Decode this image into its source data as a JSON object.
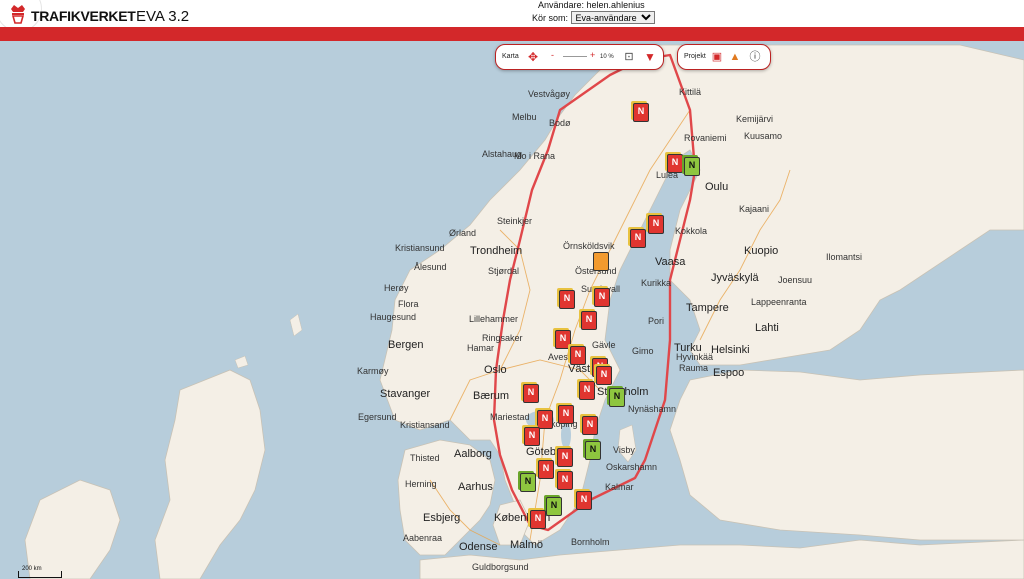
{
  "header": {
    "brand": "TRAFIKVERKET",
    "app_title": "EVA 3.2",
    "user_label": "Användare: helen.ahlenius",
    "run_as_label": "Kör som:",
    "run_as_selected": "Eva-användare"
  },
  "map_toolbar": {
    "label": "Karta",
    "zoom_minus": "-",
    "zoom_plus": "+",
    "zoom_level": "10 %"
  },
  "project_toolbar": {
    "label": "Projekt"
  },
  "map_labels": [
    {
      "text": "Bodø",
      "big": false
    },
    {
      "text": "Luleå",
      "big": false
    },
    {
      "text": "Oulu",
      "big": true
    },
    {
      "text": "Rovaniemi",
      "big": false
    },
    {
      "text": "Trondheim",
      "big": true
    },
    {
      "text": "Kristiansund",
      "big": false
    },
    {
      "text": "Ålesund",
      "big": false
    },
    {
      "text": "Örnsköldsvik",
      "big": false
    },
    {
      "text": "Östersund",
      "big": false
    },
    {
      "text": "Sundsvall",
      "big": false
    },
    {
      "text": "Vaasa",
      "big": true
    },
    {
      "text": "Kuopio",
      "big": true
    },
    {
      "text": "Jyväskylä",
      "big": true
    },
    {
      "text": "Tampere",
      "big": true
    },
    {
      "text": "Lahti",
      "big": true
    },
    {
      "text": "Turku",
      "big": true
    },
    {
      "text": "Helsinki",
      "big": true
    },
    {
      "text": "Espoo",
      "big": true
    },
    {
      "text": "Bergen",
      "big": true
    },
    {
      "text": "Stavanger",
      "big": true
    },
    {
      "text": "Oslo",
      "big": true
    },
    {
      "text": "Bærum",
      "big": true
    },
    {
      "text": "Kristiansand",
      "big": false
    },
    {
      "text": "Gävle",
      "big": false
    },
    {
      "text": "Västerås",
      "big": true
    },
    {
      "text": "Stockholm",
      "big": true
    },
    {
      "text": "Göteborg",
      "big": true
    },
    {
      "text": "Aalborg",
      "big": true
    },
    {
      "text": "Aarhus",
      "big": true
    },
    {
      "text": "Esbjerg",
      "big": true
    },
    {
      "text": "København",
      "big": true
    },
    {
      "text": "Malmö",
      "big": true
    },
    {
      "text": "Odense",
      "big": true
    },
    {
      "text": "Visby",
      "big": false
    },
    {
      "text": "Kalmar",
      "big": false
    },
    {
      "text": "Oskarshamn",
      "big": false
    },
    {
      "text": "Nynäshamn",
      "big": false
    },
    {
      "text": "Mariestad",
      "big": false
    },
    {
      "text": "Linköping",
      "big": false
    },
    {
      "text": "Herning",
      "big": false
    },
    {
      "text": "Thisted",
      "big": false
    },
    {
      "text": "Haugesund",
      "big": false
    },
    {
      "text": "Karmøy",
      "big": false
    },
    {
      "text": "Egersund",
      "big": false
    },
    {
      "text": "Lillehammer",
      "big": false
    },
    {
      "text": "Ringsaker",
      "big": false
    },
    {
      "text": "Steinkjer",
      "big": false
    },
    {
      "text": "Mo i Rana",
      "big": false
    },
    {
      "text": "Kemijärvi",
      "big": false
    },
    {
      "text": "Kuusamo",
      "big": false
    },
    {
      "text": "Kajaani",
      "big": false
    },
    {
      "text": "Joensuu",
      "big": false
    },
    {
      "text": "Lappeenranta",
      "big": false
    },
    {
      "text": "Pori",
      "big": false
    },
    {
      "text": "Kokkola",
      "big": false
    },
    {
      "text": "Kurikka",
      "big": false
    },
    {
      "text": "Ilomantsi",
      "big": false
    },
    {
      "text": "Bornholm",
      "big": false
    },
    {
      "text": "Guldborgsund",
      "big": false
    },
    {
      "text": "Aabenraa",
      "big": false
    },
    {
      "text": "Rauma",
      "big": false
    },
    {
      "text": "Melbu",
      "big": false
    },
    {
      "text": "Alstahaug",
      "big": false
    },
    {
      "text": "Vestvågøy",
      "big": false
    },
    {
      "text": "Kittilä",
      "big": false
    },
    {
      "text": "Ørland",
      "big": false
    },
    {
      "text": "Hyvinkää",
      "big": false
    },
    {
      "text": "Hamar",
      "big": false
    },
    {
      "text": "Flora",
      "big": false
    },
    {
      "text": "Herøy",
      "big": false
    },
    {
      "text": "Stjørdal",
      "big": false
    },
    {
      "text": "Gimo",
      "big": false
    },
    {
      "text": "Avesta",
      "big": false
    }
  ],
  "markers": [
    {
      "letter": "N",
      "color": "red"
    },
    {
      "letter": "N",
      "color": "red"
    },
    {
      "letter": "N",
      "color": "green"
    },
    {
      "letter": "N",
      "color": "red"
    },
    {
      "letter": "N",
      "color": "red"
    },
    {
      "letter": "",
      "color": "orange"
    },
    {
      "letter": "N",
      "color": "red"
    },
    {
      "letter": "N",
      "color": "red"
    },
    {
      "letter": "N",
      "color": "red"
    },
    {
      "letter": "N",
      "color": "red"
    },
    {
      "letter": "N",
      "color": "red"
    },
    {
      "letter": "N",
      "color": "red"
    },
    {
      "letter": "N",
      "color": "red"
    },
    {
      "letter": "N",
      "color": "red"
    },
    {
      "letter": "N",
      "color": "green"
    },
    {
      "letter": "N",
      "color": "red"
    },
    {
      "letter": "N",
      "color": "red"
    },
    {
      "letter": "N",
      "color": "red"
    },
    {
      "letter": "N",
      "color": "red"
    },
    {
      "letter": "N",
      "color": "green"
    },
    {
      "letter": "N",
      "color": "red"
    },
    {
      "letter": "N",
      "color": "red"
    },
    {
      "letter": "N",
      "color": "green"
    },
    {
      "letter": "N",
      "color": "red"
    },
    {
      "letter": "N",
      "color": "red"
    },
    {
      "letter": "N",
      "color": "green"
    },
    {
      "letter": "N",
      "color": "red"
    },
    {
      "letter": "N",
      "color": "red"
    }
  ],
  "scale": {
    "label": "200 km"
  },
  "colors": {
    "brand_red": "#d3282a",
    "route_red": "#e0474a",
    "water": "#b7cddb",
    "land": "#f4efe6"
  }
}
